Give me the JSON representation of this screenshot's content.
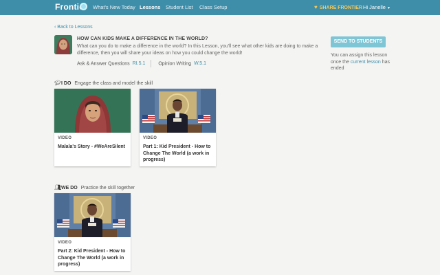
{
  "nav": {
    "logo": "Frontier",
    "items": [
      "What's New Today",
      "Lessons",
      "Student List",
      "Class Setup"
    ],
    "active_index": 1,
    "share_label": "SHARE FRONTIER",
    "user_label": "Hi Janelle",
    "accent": "#3f8ea9"
  },
  "back_link": "Back to Lessons",
  "lesson": {
    "title": "HOW CAN KIDS MAKE A DIFFERENCE IN THE WORLD?",
    "description": "What can you do to make a difference in the world? In this Lesson, you'll see what other kids are doing to make a difference, then you will share your ideas on how you could change the world!",
    "standards": [
      {
        "label": "Ask & Answer Questions",
        "code": "RI.5.1"
      },
      {
        "label": "Opinion Writing",
        "code": "W.5.1"
      }
    ]
  },
  "sidebar": {
    "send_button": "SEND TO STUDENTS",
    "note_before": "You can assign this lesson once the",
    "note_link": "current lesson",
    "note_after": "has ended"
  },
  "sections": [
    {
      "tag": "I DO",
      "subtitle": "Engage the class and model the skill",
      "icon": "graduation-cap-icon",
      "cards": [
        {
          "kind": "VIDEO",
          "title": "Malala's Story - #WeAreSilent",
          "thumb": "girl-headscarf"
        },
        {
          "kind": "VIDEO",
          "title": "Part 1: Kid President - How to Change The World (a work in progress)",
          "thumb": "kid-president"
        }
      ]
    },
    {
      "tag": "WE DO",
      "subtitle": "Practice the skill together",
      "icon": "group-icon",
      "cards": [
        {
          "kind": "VIDEO",
          "title": "Part 2: Kid President - How to Change The World (a work in progress)",
          "thumb": "kid-president"
        }
      ]
    }
  ]
}
